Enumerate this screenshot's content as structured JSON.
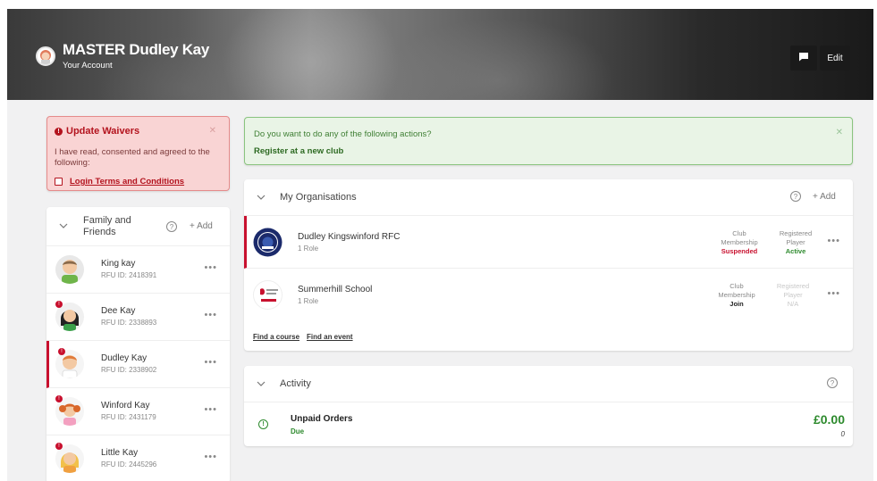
{
  "header": {
    "name": "MASTER Dudley Kay",
    "subtitle": "Your Account",
    "edit_label": "Edit"
  },
  "waiver": {
    "title": "Update Waivers",
    "text": "I have read, consented and agreed to the following:",
    "link": "Login Terms and Conditions"
  },
  "family": {
    "title_line1": "Family and",
    "title_line2": "Friends",
    "add_label": "+ Add",
    "members": [
      {
        "name": "King kay",
        "id": "RFU ID: 2418391"
      },
      {
        "name": "Dee Kay",
        "id": "RFU ID: 2338893"
      },
      {
        "name": "Dudley Kay",
        "id": "RFU ID: 2338902"
      },
      {
        "name": "Winford Kay",
        "id": "RFU ID: 2431179"
      },
      {
        "name": "Little Kay",
        "id": "RFU ID: 2445296"
      }
    ]
  },
  "actions": {
    "question": "Do you want to do any of the following actions?",
    "link": "Register at a new club"
  },
  "organisations": {
    "title": "My Organisations",
    "add_label": "+ Add",
    "rows": [
      {
        "name": "Dudley Kingswinford RFC",
        "role": "1 Role",
        "club_label1": "Club",
        "club_label2": "Membership",
        "club_value": "Suspended",
        "player_label1": "Registered",
        "player_label2": "Player",
        "player_value": "Active"
      },
      {
        "name": "Summerhill School",
        "role": "1 Role",
        "club_label1": "Club",
        "club_label2": "Membership",
        "club_value": "Join",
        "player_label1": "Registered",
        "player_label2": "Player",
        "player_value": "N/A"
      }
    ],
    "find_course": "Find a course",
    "find_event": "Find an event"
  },
  "activity": {
    "title": "Activity",
    "unpaid_title": "Unpaid Orders",
    "unpaid_status": "Due",
    "amount": "£0.00",
    "count": "0"
  },
  "colors": {
    "brand_red": "#c8102e",
    "success_green": "#2d8a2d"
  }
}
